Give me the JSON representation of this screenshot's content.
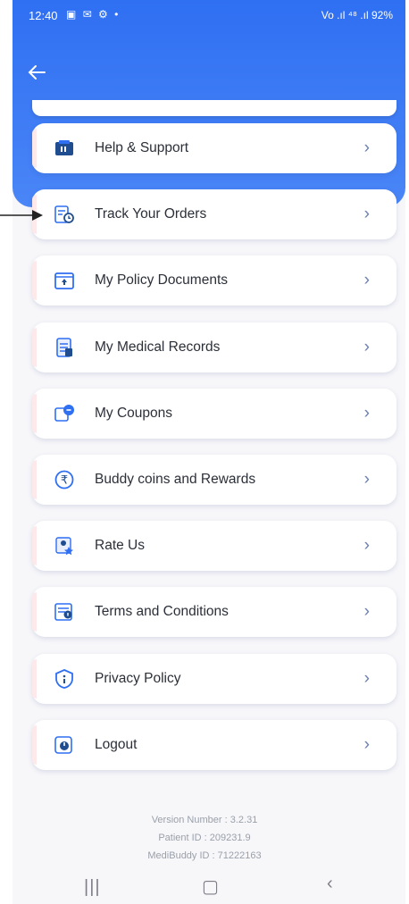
{
  "status_bar": {
    "time": "12:40",
    "left_icons": "▣ ✉ ⚙ •",
    "right_text": "Vo .ıl ⁴⁸ .ıl 92%"
  },
  "header": {
    "back_icon": "arrow-left-icon",
    "brand_color": "#2f6ff2"
  },
  "menu": {
    "items": [
      {
        "label": "Help & Support",
        "icon": "help-support-icon"
      },
      {
        "label": "Track Your Orders",
        "icon": "track-orders-icon"
      },
      {
        "label": "My Policy Documents",
        "icon": "policy-documents-icon"
      },
      {
        "label": "My Medical Records",
        "icon": "medical-records-icon"
      },
      {
        "label": "My Coupons",
        "icon": "coupons-icon"
      },
      {
        "label": "Buddy coins and Rewards",
        "icon": "rupee-coin-icon"
      },
      {
        "label": "Rate Us",
        "icon": "rate-us-icon"
      },
      {
        "label": "Terms and Conditions",
        "icon": "terms-icon"
      },
      {
        "label": "Privacy Policy",
        "icon": "privacy-shield-icon"
      },
      {
        "label": "Logout",
        "icon": "logout-icon"
      }
    ],
    "chevron": "›"
  },
  "footer": {
    "version": "Version Number : 3.2.31",
    "patient_id": "Patient ID : 209231.9",
    "buddy_id": "MediBuddy ID : 71222163"
  },
  "navbar": {
    "recents": "|||",
    "home": "▢",
    "back": "‹"
  }
}
